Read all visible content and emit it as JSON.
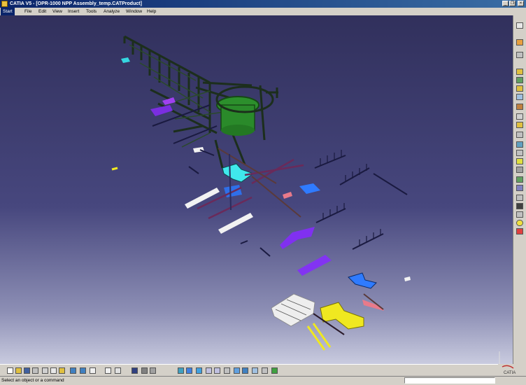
{
  "window": {
    "title": "CATIA V5 - [OPR-1000 NPP Assembly_temp.CATProduct]",
    "minimize_glyph": "_",
    "restore_glyph": "❐",
    "close_glyph": "×"
  },
  "menu": {
    "start": "Start",
    "items": [
      "File",
      "Edit",
      "View",
      "Insert",
      "Tools",
      "Analyze",
      "Window",
      "Help"
    ]
  },
  "viewport": {
    "background_top": "#31305c",
    "background_bottom": "#c9cbdf",
    "structure_color": "#1e3a1e",
    "dome_color": "#2e9e2e"
  },
  "right_toolbar_icons": [
    "select-arrow-icon",
    "product-icon",
    "component-icon",
    "existing-component-icon",
    "replace-component-icon",
    "graph-tree-icon",
    "generate-numbering-icon",
    "selective-load-icon",
    "manage-representations-icon",
    "multi-instantiation-icon",
    "fast-multi-instantiation-icon",
    "reorder-icon",
    "manipulation-icon",
    "snap-icon",
    "explode-icon",
    "stop-manipulate-icon",
    "constraint-icon",
    "fix-icon",
    "update-icon",
    "analyze-icon",
    "lightbulb-icon",
    "delete-icon"
  ],
  "bottom_toolbar_icons": [
    "new-icon",
    "open-icon",
    "save-icon",
    "print-icon",
    "cut-icon",
    "copy-icon",
    "paste-icon",
    "undo-icon",
    "redo-icon",
    "whats-this-icon",
    "formula-icon",
    "catalog-icon",
    "bom-icon",
    "measure-icon",
    "fly-mode-icon",
    "fit-all-icon",
    "pan-icon",
    "rotate-icon",
    "zoom-in-icon",
    "zoom-out-icon",
    "normal-view-icon",
    "iso-view-icon",
    "shading-icon",
    "hide-show-icon",
    "swap-visible-icon",
    "render-icon"
  ],
  "status": {
    "message": "Select an object or a command",
    "logo_text": "CATIA"
  }
}
